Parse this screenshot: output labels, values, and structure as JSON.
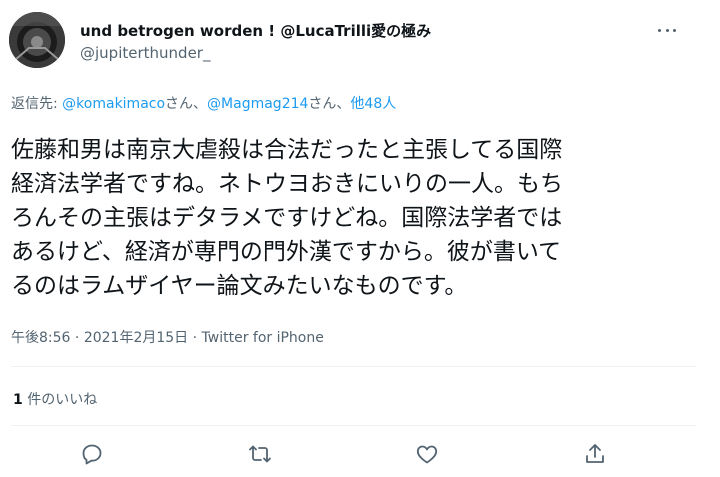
{
  "author": {
    "display_name": "und betrogen worden ! @LucaTrilli愛の極み",
    "handle": "@jupiterthunder_"
  },
  "reply": {
    "prefix": "返信先: ",
    "mention_1": "@komakimaco",
    "sep_1": "さん、",
    "mention_2": "@Magmag214",
    "sep_2": "さん、",
    "others": "他48人"
  },
  "tweet": {
    "lines": [
      "佐藤和男は南京大虐殺は合法だったと主張してる国際",
      "経済法学者ですね。ネトウヨおきにいりの一人。もち",
      "ろんその主張はデタラメですけどね。国際法学者では",
      "あるけど、経済が専門の門外漢ですから。彼が書いて",
      "るのはラムザイヤー論文みたいなものです。"
    ]
  },
  "meta": {
    "time": "午後8:56",
    "dot_1": " · ",
    "date": "2021年2月15日",
    "dot_2": " · ",
    "source": "Twitter for iPhone"
  },
  "likes": {
    "count": "1",
    "label": " 件のいいね"
  },
  "colors": {
    "text": "#0f1419",
    "muted": "#536471",
    "accent": "#1d9bf0",
    "divider": "#eff3f4"
  },
  "icons": {
    "more": "more-horizontal-icon",
    "reply": "reply-icon",
    "retweet": "retweet-icon",
    "like": "heart-icon",
    "share": "share-icon"
  }
}
